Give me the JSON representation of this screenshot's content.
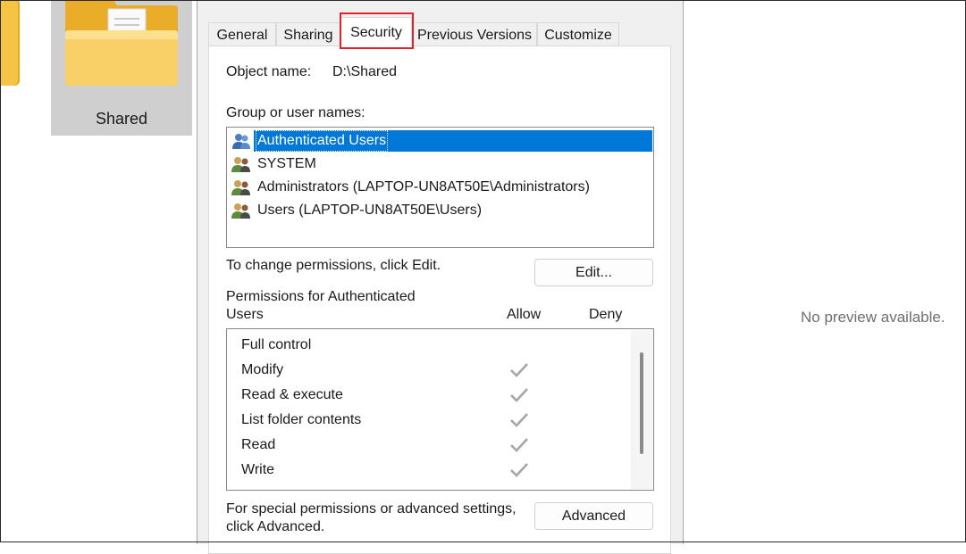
{
  "explorer": {
    "folder_label": "Shared",
    "preview_text": "No preview available."
  },
  "dialog": {
    "tabs": [
      {
        "label": "General"
      },
      {
        "label": "Sharing"
      },
      {
        "label": "Security",
        "selected": true
      },
      {
        "label": "Previous Versions"
      },
      {
        "label": "Customize"
      }
    ],
    "object_name_label": "Object name:",
    "object_name_value": "D:\\Shared",
    "group_label": "Group or user names:",
    "users": [
      {
        "name": "Authenticated Users",
        "icon": "users-group-icon",
        "selected": true
      },
      {
        "name": "SYSTEM",
        "icon": "users-group-icon"
      },
      {
        "name": "Administrators (LAPTOP-UN8AT50E\\Administrators)",
        "icon": "users-group-icon"
      },
      {
        "name": "Users (LAPTOP-UN8AT50E\\Users)",
        "icon": "users-group-icon"
      }
    ],
    "change_perm_text": "To change permissions, click Edit.",
    "edit_button": "Edit...",
    "permissions_label_line1": "Permissions for Authenticated",
    "permissions_label_line2": "Users",
    "allow_header": "Allow",
    "deny_header": "Deny",
    "permissions": [
      {
        "name": "Full control",
        "allow": false,
        "deny": false
      },
      {
        "name": "Modify",
        "allow": true,
        "deny": false
      },
      {
        "name": "Read & execute",
        "allow": true,
        "deny": false
      },
      {
        "name": "List folder contents",
        "allow": true,
        "deny": false
      },
      {
        "name": "Read",
        "allow": true,
        "deny": false
      },
      {
        "name": "Write",
        "allow": true,
        "deny": false
      }
    ],
    "special_text_line1": "For special permissions or advanced settings,",
    "special_text_line2": "click Advanced.",
    "advanced_button": "Advanced"
  },
  "colors": {
    "selection": "#0078d7",
    "highlight_border": "#e4212b",
    "check_gray": "#a6a6a6",
    "folder_yellow": "#f6c445"
  }
}
